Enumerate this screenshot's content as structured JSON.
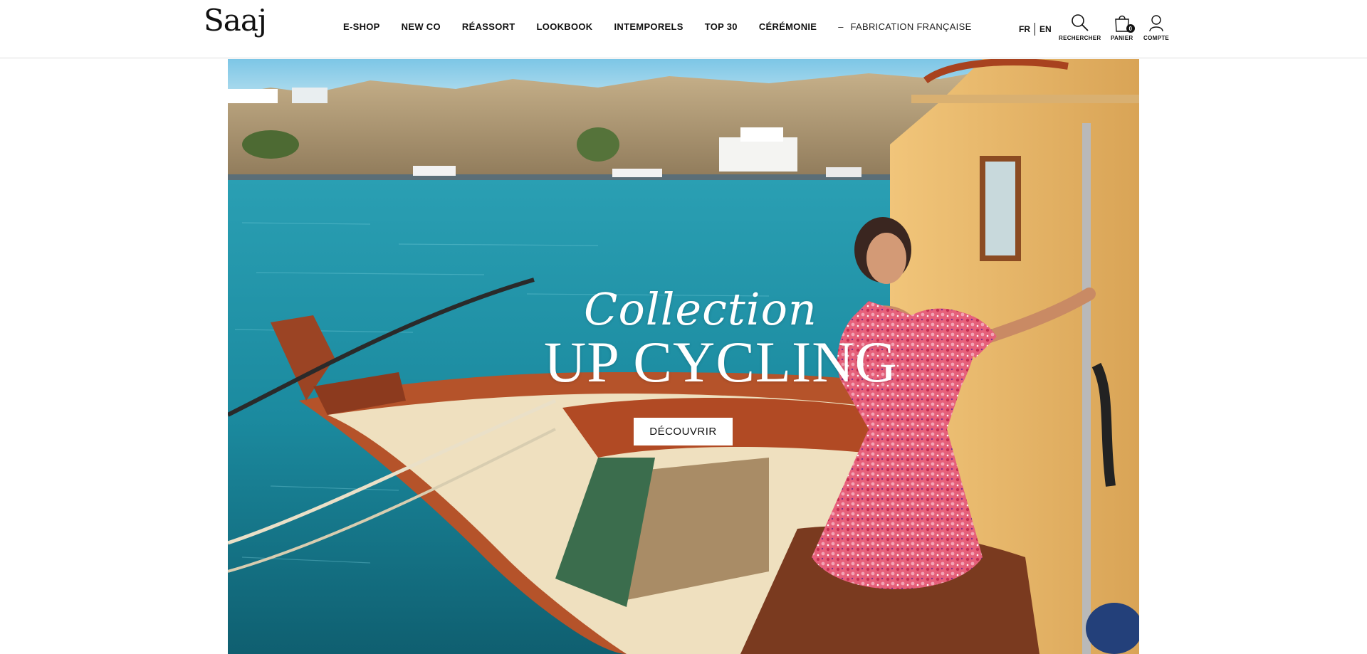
{
  "brand": {
    "logo_text": "Saaj"
  },
  "nav": {
    "items": [
      {
        "label": "E-SHOP"
      },
      {
        "label": "NEW CO"
      },
      {
        "label": "RÉASSORT"
      },
      {
        "label": "LOOKBOOK"
      },
      {
        "label": "INTEMPORELS"
      },
      {
        "label": "TOP 30"
      },
      {
        "label": "CÉRÉMONIE"
      }
    ],
    "dash": "–",
    "fabrication": "FABRICATION FRANÇAISE"
  },
  "lang": {
    "fr": "FR",
    "en": "EN"
  },
  "actions": {
    "search_label": "RECHERCHER",
    "cart_label": "PANIER",
    "cart_count": "0",
    "account_label": "COMPTE"
  },
  "hero": {
    "script_title": "Collection",
    "main_title": "UP CYCLING",
    "cta_label": "DÉCOUVRIR"
  },
  "colors": {
    "sea": "#1f8fa6",
    "sky": "#8fcbe6",
    "dress": "#d9475e",
    "boat_yellow": "#e6b66a",
    "boat_red": "#a7441e"
  }
}
